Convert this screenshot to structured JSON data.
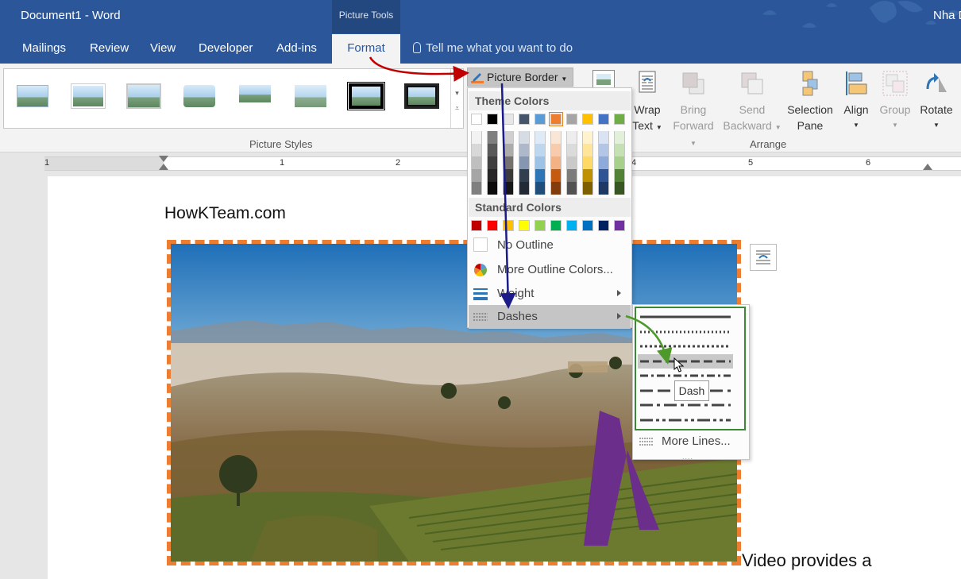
{
  "window": {
    "title": "Document1 - Word",
    "user": "Nha D"
  },
  "context_tab_group": "Picture Tools",
  "tabs": [
    {
      "label": "Mailings"
    },
    {
      "label": "Review"
    },
    {
      "label": "View"
    },
    {
      "label": "Developer"
    },
    {
      "label": "Add-ins"
    },
    {
      "label": "Format",
      "active": true
    }
  ],
  "tell_me": {
    "placeholder": "Tell me what you want to do"
  },
  "ribbon": {
    "picture_styles_label": "Picture Styles",
    "picture_border_label": "Picture Border",
    "arrange_label": "Arrange",
    "arrange_buttons": [
      {
        "line1": "Wrap",
        "line2": "Text",
        "enabled": true,
        "icon": "wrap-text-icon"
      },
      {
        "line1": "Bring",
        "line2": "Forward",
        "enabled": false,
        "icon": "bring-forward-icon"
      },
      {
        "line1": "Send",
        "line2": "Backward",
        "enabled": false,
        "icon": "send-backward-icon"
      },
      {
        "line1": "Selection",
        "line2": "Pane",
        "enabled": true,
        "icon": "selection-pane-icon"
      },
      {
        "line1": "Align",
        "line2": "",
        "enabled": true,
        "icon": "align-icon"
      },
      {
        "line1": "Group",
        "line2": "",
        "enabled": false,
        "icon": "group-icon"
      },
      {
        "line1": "Rotate",
        "line2": "",
        "enabled": true,
        "icon": "rotate-icon"
      }
    ]
  },
  "ruler": {
    "numbers": [
      "1",
      "1",
      "2",
      "4",
      "5",
      "6"
    ]
  },
  "document": {
    "heading": "HowKTeam.com",
    "body_text": "Video provides a",
    "picture_border_color": "#ed7d31"
  },
  "border_menu": {
    "theme_colors_label": "Theme Colors",
    "standard_colors_label": "Standard Colors",
    "theme_colors": [
      "#ffffff",
      "#000000",
      "#e7e6e6",
      "#44546a",
      "#5b9bd5",
      "#ed7d31",
      "#a5a5a5",
      "#ffc000",
      "#4472c4",
      "#70ad47"
    ],
    "theme_shades": [
      [
        "#f2f2f2",
        "#7f7f7f",
        "#d0cece",
        "#d6dce4",
        "#deebf6",
        "#fbe5d5",
        "#ededed",
        "#fff2cc",
        "#dae3f3",
        "#e2efd9"
      ],
      [
        "#d8d8d8",
        "#595959",
        "#aeabab",
        "#adb9ca",
        "#bdd7ee",
        "#f8cbad",
        "#dbdbdb",
        "#fee599",
        "#b4c6e7",
        "#c5e0b3"
      ],
      [
        "#bfbfbf",
        "#3f3f3f",
        "#757070",
        "#8496b0",
        "#9cc3e5",
        "#f4b183",
        "#c9c9c9",
        "#ffd965",
        "#8eaadb",
        "#a8d08d"
      ],
      [
        "#a5a5a5",
        "#262626",
        "#3a3838",
        "#323f4f",
        "#2e75b5",
        "#c55a11",
        "#7b7b7b",
        "#bf9000",
        "#2f5496",
        "#538135"
      ],
      [
        "#7f7f7f",
        "#0c0c0c",
        "#171616",
        "#222a35",
        "#1e4e79",
        "#833c0b",
        "#525252",
        "#7f6000",
        "#1f3864",
        "#375623"
      ]
    ],
    "selected_color": "#ed7d31",
    "standard_colors": [
      "#c00000",
      "#ff0000",
      "#ffc000",
      "#ffff00",
      "#92d050",
      "#00b050",
      "#00b0f0",
      "#0070c0",
      "#002060",
      "#7030a0"
    ],
    "no_outline": "No Outline",
    "more_colors": "More Outline Colors...",
    "weight": "Weight",
    "dashes": "Dashes"
  },
  "dashes_menu": {
    "options": [
      "solid",
      "round-dot",
      "square-dot",
      "dash",
      "dash-dot",
      "long-dash",
      "long-dash-dot",
      "long-dash-dot-dot"
    ],
    "hovered": "dash",
    "more_lines": "More Lines...",
    "tooltip": "Dash"
  }
}
